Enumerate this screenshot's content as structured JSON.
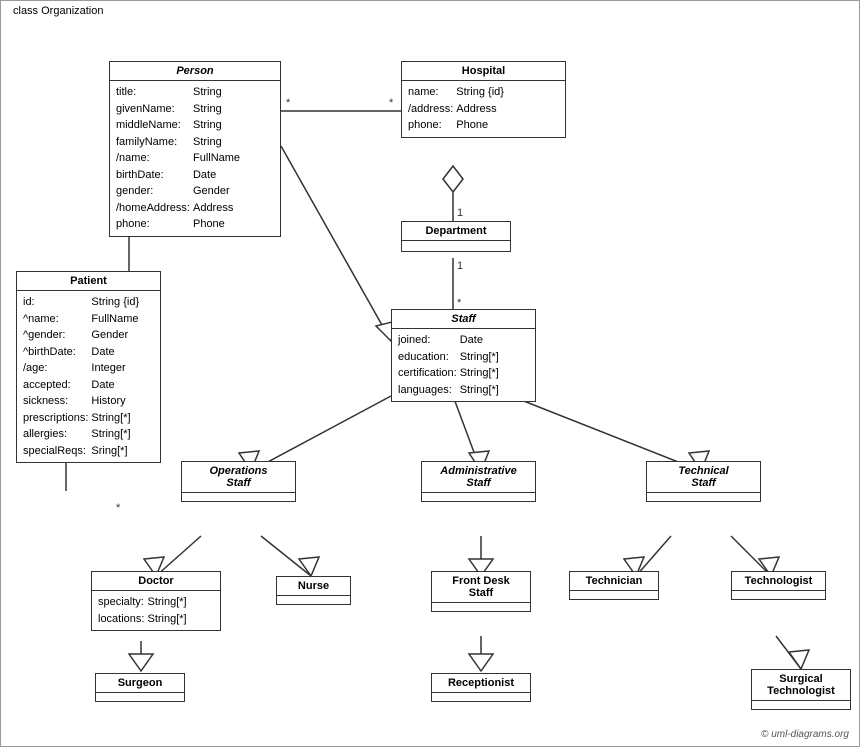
{
  "diagram": {
    "title": "class Organization",
    "copyright": "© uml-diagrams.org",
    "classes": {
      "person": {
        "name": "Person",
        "italic": true,
        "attributes": [
          [
            "title:",
            "String"
          ],
          [
            "givenName:",
            "String"
          ],
          [
            "middleName:",
            "String"
          ],
          [
            "familyName:",
            "String"
          ],
          [
            "/name:",
            "FullName"
          ],
          [
            "birthDate:",
            "Date"
          ],
          [
            "gender:",
            "Gender"
          ],
          [
            "/homeAddress:",
            "Address"
          ],
          [
            "phone:",
            "Phone"
          ]
        ]
      },
      "hospital": {
        "name": "Hospital",
        "italic": false,
        "attributes": [
          [
            "name:",
            "String {id}"
          ],
          [
            "/address:",
            "Address"
          ],
          [
            "phone:",
            "Phone"
          ]
        ]
      },
      "department": {
        "name": "Department",
        "italic": false,
        "attributes": []
      },
      "staff": {
        "name": "Staff",
        "italic": true,
        "attributes": [
          [
            "joined:",
            "Date"
          ],
          [
            "education:",
            "String[*]"
          ],
          [
            "certification:",
            "String[*]"
          ],
          [
            "languages:",
            "String[*]"
          ]
        ]
      },
      "patient": {
        "name": "Patient",
        "italic": false,
        "attributes": [
          [
            "id:",
            "String {id}"
          ],
          [
            "^name:",
            "FullName"
          ],
          [
            "^gender:",
            "Gender"
          ],
          [
            "^birthDate:",
            "Date"
          ],
          [
            "/age:",
            "Integer"
          ],
          [
            "accepted:",
            "Date"
          ],
          [
            "sickness:",
            "History"
          ],
          [
            "prescriptions:",
            "String[*]"
          ],
          [
            "allergies:",
            "String[*]"
          ],
          [
            "specialReqs:",
            "Sring[*]"
          ]
        ]
      },
      "operations_staff": {
        "name": "Operations Staff",
        "italic": true,
        "attributes": []
      },
      "administrative_staff": {
        "name": "Administrative Staff",
        "italic": true,
        "attributes": []
      },
      "technical_staff": {
        "name": "Technical Staff",
        "italic": true,
        "attributes": []
      },
      "doctor": {
        "name": "Doctor",
        "italic": false,
        "attributes": [
          [
            "specialty:",
            "String[*]"
          ],
          [
            "locations:",
            "String[*]"
          ]
        ]
      },
      "nurse": {
        "name": "Nurse",
        "italic": false,
        "attributes": []
      },
      "front_desk_staff": {
        "name": "Front Desk Staff",
        "italic": false,
        "attributes": []
      },
      "technician": {
        "name": "Technician",
        "italic": false,
        "attributes": []
      },
      "technologist": {
        "name": "Technologist",
        "italic": false,
        "attributes": []
      },
      "surgeon": {
        "name": "Surgeon",
        "italic": false,
        "attributes": []
      },
      "receptionist": {
        "name": "Receptionist",
        "italic": false,
        "attributes": []
      },
      "surgical_technologist": {
        "name": "Surgical Technologist",
        "italic": false,
        "attributes": []
      }
    }
  }
}
